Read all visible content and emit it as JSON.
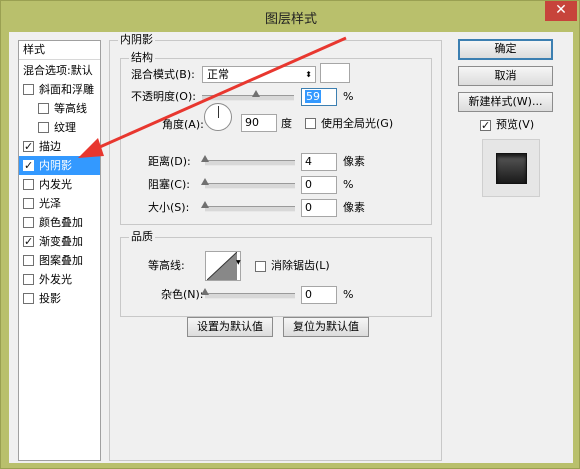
{
  "window": {
    "title": "图层样式",
    "close_glyph": "✕"
  },
  "left_panel": {
    "header": "样式",
    "items": [
      {
        "label": "混合选项:默认",
        "has_checkbox": false,
        "checked": false,
        "indent": 0,
        "selected": false
      },
      {
        "label": "斜面和浮雕",
        "has_checkbox": true,
        "checked": false,
        "indent": 0,
        "selected": false
      },
      {
        "label": "等高线",
        "has_checkbox": true,
        "checked": false,
        "indent": 1,
        "selected": false
      },
      {
        "label": "纹理",
        "has_checkbox": true,
        "checked": false,
        "indent": 1,
        "selected": false
      },
      {
        "label": "描边",
        "has_checkbox": true,
        "checked": true,
        "indent": 0,
        "selected": false
      },
      {
        "label": "内阴影",
        "has_checkbox": true,
        "checked": true,
        "indent": 0,
        "selected": true
      },
      {
        "label": "内发光",
        "has_checkbox": true,
        "checked": false,
        "indent": 0,
        "selected": false
      },
      {
        "label": "光泽",
        "has_checkbox": true,
        "checked": false,
        "indent": 0,
        "selected": false
      },
      {
        "label": "颜色叠加",
        "has_checkbox": true,
        "checked": false,
        "indent": 0,
        "selected": false
      },
      {
        "label": "渐变叠加",
        "has_checkbox": true,
        "checked": true,
        "indent": 0,
        "selected": false
      },
      {
        "label": "图案叠加",
        "has_checkbox": true,
        "checked": false,
        "indent": 0,
        "selected": false
      },
      {
        "label": "外发光",
        "has_checkbox": true,
        "checked": false,
        "indent": 0,
        "selected": false
      },
      {
        "label": "投影",
        "has_checkbox": true,
        "checked": false,
        "indent": 0,
        "selected": false
      }
    ]
  },
  "inner_shadow": {
    "section_title": "内阴影",
    "structure": {
      "title": "结构",
      "blend_mode_label": "混合模式(B):",
      "blend_mode_value": "正常",
      "opacity_label": "不透明度(O):",
      "opacity_value": "59",
      "opacity_unit": "%",
      "opacity_level": 0.59,
      "angle_label": "角度(A):",
      "angle_value": "90",
      "angle_unit": "度",
      "global_light_label": "使用全局光(G)",
      "global_light_checked": false,
      "distance_label": "距离(D):",
      "distance_value": "4",
      "distance_unit": "像素",
      "choke_label": "阻塞(C):",
      "choke_value": "0",
      "choke_unit": "%",
      "size_label": "大小(S):",
      "size_value": "0",
      "size_unit": "像素"
    },
    "quality": {
      "title": "品质",
      "contour_label": "等高线:",
      "antialias_label": "消除锯齿(L)",
      "antialias_checked": false,
      "noise_label": "杂色(N):",
      "noise_value": "0",
      "noise_unit": "%"
    },
    "make_default_label": "设置为默认值",
    "reset_default_label": "复位为默认值"
  },
  "right_panel": {
    "ok_label": "确定",
    "cancel_label": "取消",
    "new_style_label": "新建样式(W)...",
    "preview_label": "预览(V)",
    "preview_checked": true
  },
  "annotation": {
    "arrow_color": "#e8372f"
  }
}
